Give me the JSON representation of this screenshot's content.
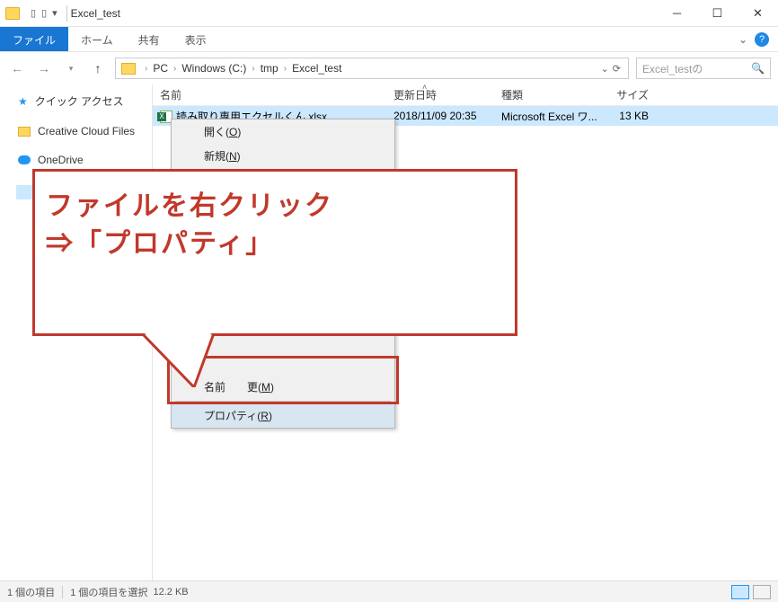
{
  "window": {
    "title": "Excel_test"
  },
  "ribbon": {
    "file": "ファイル",
    "home": "ホーム",
    "share": "共有",
    "view": "表示"
  },
  "breadcrumb": {
    "items": [
      "PC",
      "Windows (C:)",
      "tmp",
      "Excel_test"
    ]
  },
  "search": {
    "placeholder": "Excel_testの"
  },
  "sidebar": {
    "quick_access": "クイック アクセス",
    "creative_cloud": "Creative Cloud Files",
    "onedrive": "OneDrive"
  },
  "columns": {
    "name": "名前",
    "date": "更新日時",
    "type": "種類",
    "size": "サイズ"
  },
  "file": {
    "name": "読み取り専用エクセルくん.xlsx",
    "date": "2018/11/09 20:35",
    "type": "Microsoft Excel ワ...",
    "size": "13 KB"
  },
  "context_menu": {
    "open": "開く(",
    "open_k": "O",
    "open_end": ")",
    "new": "新規(",
    "new_k": "N",
    "new_end": ")",
    "rename_prefix": "名前",
    "rename_suffix": "更(",
    "rename_k": "M",
    "rename_end": ")",
    "properties": "プロパティ(",
    "properties_k": "R",
    "properties_end": ")"
  },
  "annotation": {
    "line1": "ファイルを右クリック",
    "line2": "⇒「プロパティ」"
  },
  "status": {
    "items": "1 個の項目",
    "selected": "1 個の項目を選択",
    "size": "12.2 KB"
  }
}
